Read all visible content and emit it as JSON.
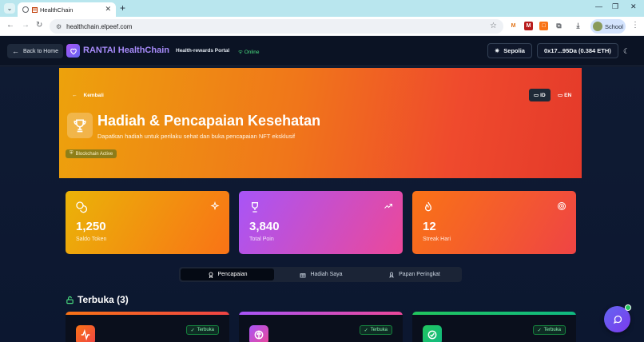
{
  "browser": {
    "tab_title": "HealthChain",
    "url": "healthchain.elpeef.com",
    "profile_label": "School"
  },
  "header": {
    "back_home": "Back to Home",
    "brand": "RANTAI HealthChain",
    "portal_label": "Health-rewards Portal",
    "status": "Online",
    "network": "Sepolia",
    "wallet": "0x17...95Da (0.384 ETH)"
  },
  "hero": {
    "back_label": "Kembali",
    "lang_id": "ID",
    "lang_en": "EN",
    "title": "Hadiah & Pencapaian Kesehatan",
    "subtitle": "Dapatkan hadiah untuk perilaku sehat dan buka pencapaian NFT eksklusif",
    "badge": "Blockchain Active"
  },
  "stats": [
    {
      "value": "1,250",
      "label": "Saldo Token"
    },
    {
      "value": "3,840",
      "label": "Total Poin"
    },
    {
      "value": "12",
      "label": "Streak Hari"
    }
  ],
  "tabs": [
    {
      "label": "Pencapaian"
    },
    {
      "label": "Hadiah Saya"
    },
    {
      "label": "Papan Peringkat"
    }
  ],
  "section": {
    "title": "Terbuka (3)"
  },
  "cards": [
    {
      "badge": "Terbuka"
    },
    {
      "badge": "Terbuka"
    },
    {
      "badge": "Terbuka"
    }
  ],
  "colors": {
    "hero_gradient_start": "#eda20c",
    "hero_gradient_end": "#e43a2a",
    "accent_purple": "#a78bfa",
    "online_green": "#4ade80"
  }
}
